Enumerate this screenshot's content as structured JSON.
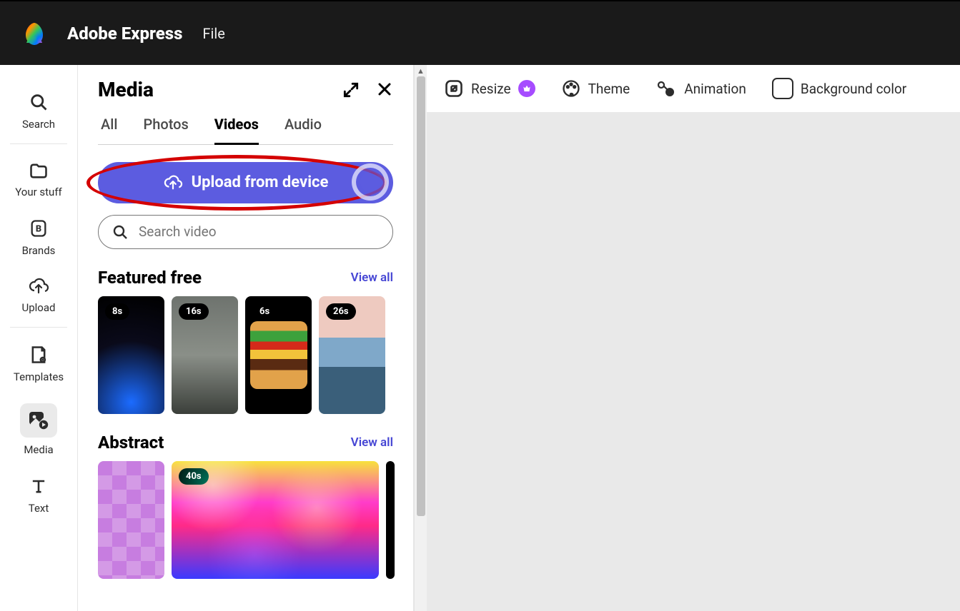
{
  "header": {
    "app_title": "Adobe Express",
    "file_menu": "File"
  },
  "sidebar": {
    "items": [
      {
        "label": "Search"
      },
      {
        "label": "Your stuff"
      },
      {
        "label": "Brands"
      },
      {
        "label": "Upload"
      },
      {
        "label": "Templates"
      },
      {
        "label": "Media"
      },
      {
        "label": "Text"
      }
    ]
  },
  "panel": {
    "title": "Media",
    "tabs": [
      "All",
      "Photos",
      "Videos",
      "Audio"
    ],
    "active_tab": "Videos",
    "upload_label": "Upload from device",
    "search_placeholder": "Search video",
    "sections": {
      "featured": {
        "title": "Featured free",
        "view_all": "View all",
        "items": [
          {
            "duration": "8s"
          },
          {
            "duration": "16s"
          },
          {
            "duration": "6s"
          },
          {
            "duration": "26s"
          }
        ]
      },
      "abstract": {
        "title": "Abstract",
        "view_all": "View all",
        "items": [
          {
            "duration": ""
          },
          {
            "duration": "40s"
          },
          {
            "duration": ""
          }
        ]
      }
    }
  },
  "actionbar": {
    "resize": "Resize",
    "theme": "Theme",
    "animation": "Animation",
    "background": "Background color"
  },
  "colors": {
    "accent": "#5c5ce0",
    "highlight": "#d40000",
    "link": "#4646d4"
  }
}
